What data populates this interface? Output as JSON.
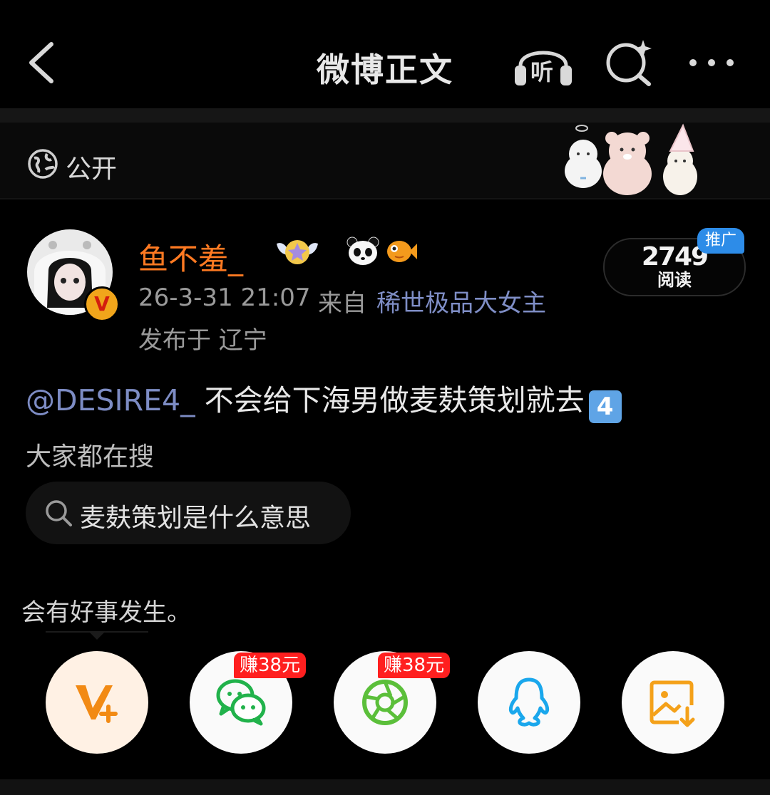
{
  "nav": {
    "title": "微博正文",
    "listen_label": "听"
  },
  "visibility": {
    "label": "公开"
  },
  "author": {
    "name": "鱼不羞_",
    "verified_badge": "V",
    "time": "26-3-31 21:07",
    "from_label": "来自",
    "source": "稀世极品大女主",
    "location": "发布于 辽宁"
  },
  "views": {
    "count": "2749",
    "label": "阅读",
    "promo_tag": "推广"
  },
  "post": {
    "mention": "@DESIRE4_",
    "text": " 不会给下海男做麦麸策划就去",
    "emoji_number": "4"
  },
  "related": {
    "heading": "大家都在搜",
    "query": "麦麸策划是什么意思"
  },
  "caption": "会有好事发生。",
  "share": [
    {
      "name": "vplus",
      "badge": ""
    },
    {
      "name": "wechat",
      "badge": "赚38元"
    },
    {
      "name": "moments",
      "badge": "赚38元"
    },
    {
      "name": "qq",
      "badge": ""
    },
    {
      "name": "save-image",
      "badge": ""
    }
  ],
  "colors": {
    "username": "#ff7a22",
    "link": "#7d8cc4",
    "badge_red": "#ff1f1f",
    "promo_blue": "#2d8ce8",
    "wechat_green": "#21b24b",
    "qq_blue": "#1aa7ec",
    "save_orange": "#f4a11a"
  }
}
